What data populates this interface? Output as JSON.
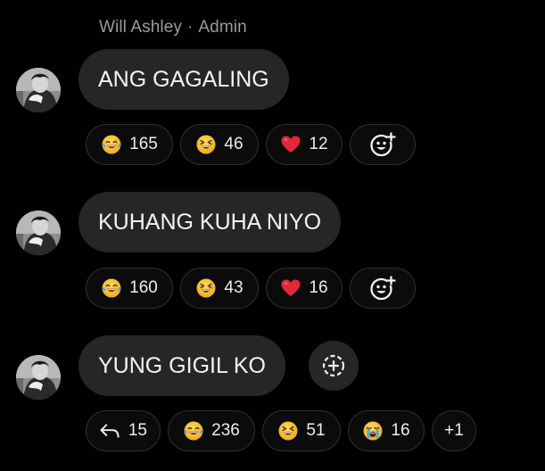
{
  "sender": {
    "name": "Will Ashley",
    "separator": "·",
    "role": "Admin"
  },
  "messages": [
    {
      "text": "ANG GAGALING",
      "reactions": [
        {
          "icon": "tears-of-joy-emoji",
          "count": "165"
        },
        {
          "icon": "squinting-laugh-emoji",
          "count": "46"
        },
        {
          "icon": "red-heart-emoji",
          "count": "12"
        }
      ]
    },
    {
      "text": "KUHANG KUHA NIYO",
      "reactions": [
        {
          "icon": "tears-of-joy-emoji",
          "count": "160"
        },
        {
          "icon": "squinting-laugh-emoji",
          "count": "43"
        },
        {
          "icon": "red-heart-emoji",
          "count": "16"
        }
      ]
    },
    {
      "text": "YUNG GIGIL KO",
      "replies": {
        "icon": "reply-arrow-icon",
        "count": "15"
      },
      "reactions": [
        {
          "icon": "tears-of-joy-emoji",
          "count": "236"
        },
        {
          "icon": "squinting-laugh-emoji",
          "count": "51"
        },
        {
          "icon": "crying-emoji",
          "count": "16"
        }
      ],
      "more": "+1"
    }
  ],
  "colors": {
    "background": "#000000",
    "bubble": "#262629",
    "pill_border": "#2e2e31",
    "sender_text": "#9a9a9e",
    "emoji_yellow": "#f7c531",
    "heart_red": "#e0283a"
  }
}
